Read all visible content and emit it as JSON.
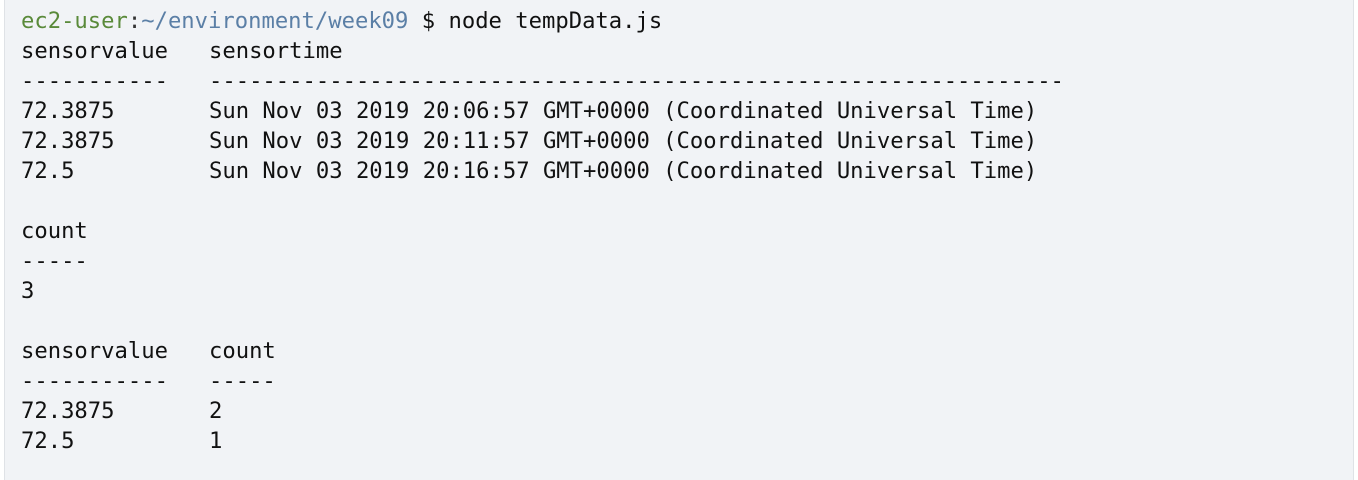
{
  "prompt": {
    "user": "ec2-user",
    "separator": ":",
    "path": "~/environment/week09",
    "symbol": " $ ",
    "command": "node tempData.js"
  },
  "table1": {
    "headers": [
      "sensorvalue",
      "sensortime"
    ],
    "rules": [
      "-----------",
      "----------------------------------------------------------------"
    ],
    "rows": [
      [
        "72.3875",
        "Sun Nov 03 2019 20:06:57 GMT+0000 (Coordinated Universal Time)"
      ],
      [
        "72.3875",
        "Sun Nov 03 2019 20:11:57 GMT+0000 (Coordinated Universal Time)"
      ],
      [
        "72.5",
        "Sun Nov 03 2019 20:16:57 GMT+0000 (Coordinated Universal Time)"
      ]
    ]
  },
  "table2": {
    "header": "count",
    "rule": "-----",
    "value": "3"
  },
  "table3": {
    "headers": [
      "sensorvalue",
      "count"
    ],
    "rules": [
      "-----------",
      "-----"
    ],
    "rows": [
      [
        "72.3875",
        "2"
      ],
      [
        "72.5",
        "1"
      ]
    ]
  }
}
